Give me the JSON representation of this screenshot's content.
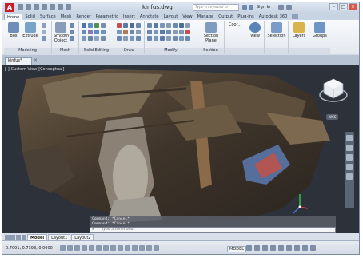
{
  "title_bar": {
    "logo_letter": "A",
    "document_title": "kinfus.dwg",
    "search_placeholder": "Type a keyword or phrase",
    "sign_in": "Sign In",
    "minimize": "–",
    "maximize": "□",
    "close": "×"
  },
  "ribbon_tabs": [
    "Home",
    "Solid",
    "Surface",
    "Mesh",
    "Render",
    "Parametric",
    "Insert",
    "Annotate",
    "Layout",
    "View",
    "Manage",
    "Output",
    "Plug-ins",
    "Autodesk 360"
  ],
  "active_tab": "Home",
  "ribbon": {
    "tools": {
      "box": "Box",
      "extrude": "Extrude",
      "smooth_object_1": "Smooth",
      "smooth_object_2": "Object",
      "section_plane_1": "Section",
      "section_plane_2": "Plane",
      "coordinates": "Coor...",
      "view": "View",
      "selection": "Selection",
      "layers": "Layers",
      "groups": "Groups"
    },
    "panels": {
      "modeling": "Modeling",
      "mesh": "Mesh",
      "solid_editing": "Solid Editing",
      "draw": "Draw",
      "modify": "Modify",
      "section": "Section"
    }
  },
  "document_tab": {
    "label": "kinfus*",
    "close": "×"
  },
  "viewport": {
    "label": "[-][Custom View][Conceptual]",
    "wcs": "WCS"
  },
  "command_line": {
    "history": [
      "Command: *Cancel*",
      "Command: *Cancel*"
    ],
    "prompt": "»",
    "placeholder": "Type a command"
  },
  "layout_tabs": [
    "Model",
    "Layout1",
    "Layout2"
  ],
  "active_layout": "Model",
  "status_bar": {
    "coordinates": "0.7091, 0.7398, 0.0000",
    "model": "MODEL"
  },
  "colors": {
    "accent": "#c8202a",
    "viewport_bg": "#2c313a"
  }
}
